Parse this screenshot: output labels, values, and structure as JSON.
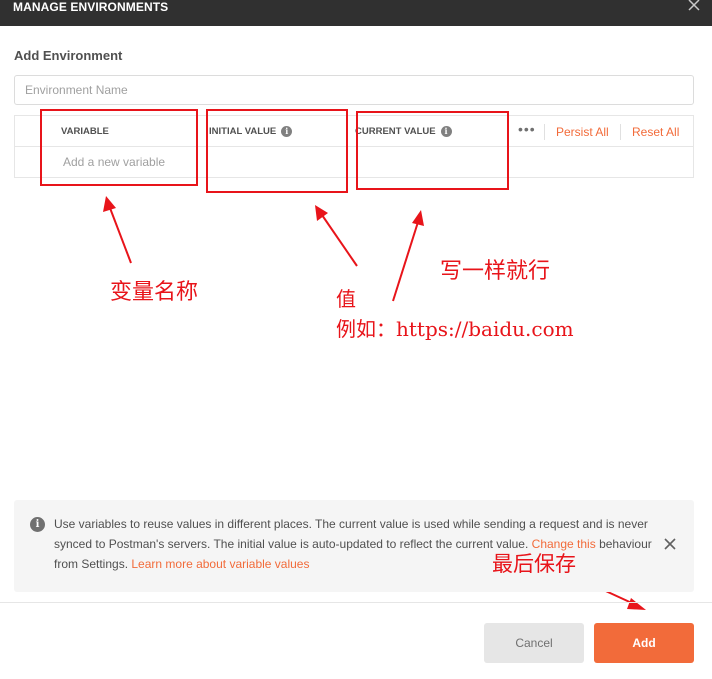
{
  "dialog": {
    "title": "MANAGE ENVIRONMENTS"
  },
  "form": {
    "section_title": "Add Environment",
    "env_name_placeholder": "Environment Name"
  },
  "table": {
    "columns": {
      "variable": "VARIABLE",
      "initial_value": "INITIAL VALUE",
      "current_value": "CURRENT VALUE"
    },
    "new_variable_placeholder": "Add a new variable",
    "more_label": "•••",
    "persist_all": "Persist All",
    "reset_all": "Reset All"
  },
  "info": {
    "text_main": "Use variables to reuse values in different places. The current value is used while sending a request and is never synced to Postman's servers. The initial value is auto-updated to reflect the current value.",
    "link_change": "Change this",
    "text_tail": "behaviour from Settings.",
    "link_learn": "Learn more about variable values"
  },
  "footer": {
    "cancel": "Cancel",
    "add": "Add"
  },
  "annotations": {
    "variable_name": "变量名称",
    "value_line1": "值",
    "value_line2": "例如：https://baidu.com",
    "same": "写一样就行",
    "save": "最后保存"
  },
  "colors": {
    "accent": "#f26b3a",
    "annotation": "#e8141a",
    "titlebar": "#303030"
  }
}
